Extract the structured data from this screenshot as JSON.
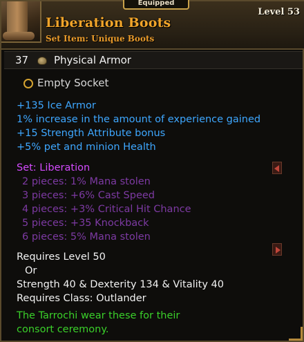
{
  "header": {
    "equipped_label": "Equipped",
    "item_name": "Liberation Boots",
    "item_type": "Set Item: Unique Boots",
    "level_label": "Level 53"
  },
  "armor": {
    "value": "37",
    "label": "Physical Armor"
  },
  "socket": {
    "label": "Empty Socket"
  },
  "stats": [
    "+135 Ice Armor",
    "1% increase in the amount of experience gained",
    "+15 Strength Attribute bonus",
    "+5% pet and minion Health"
  ],
  "set": {
    "title": "Set: Liberation",
    "pieces": [
      "2 pieces: 1% Mana stolen",
      "3 pieces: +6% Cast Speed",
      "4 pieces: +3% Critical Hit Chance",
      "5 pieces: +35 Knockback",
      "6 pieces: 5% Mana stolen"
    ]
  },
  "requirements": {
    "level": "Requires Level 50",
    "or": "Or",
    "attributes": "Strength 40 & Dexterity 134 & Vitality 40",
    "class": "Requires Class: Outlander"
  },
  "flavor": {
    "line1": "The Tarrochi wear these for their",
    "line2": "consort ceremony."
  },
  "colors": {
    "item_name": "#f0a42a",
    "magic_stat": "#3ea7ff",
    "set_title": "#d44bff",
    "set_piece_inactive": "#7d3aa3",
    "flavor": "#3ad02a",
    "frame": "#5a4a2c"
  }
}
